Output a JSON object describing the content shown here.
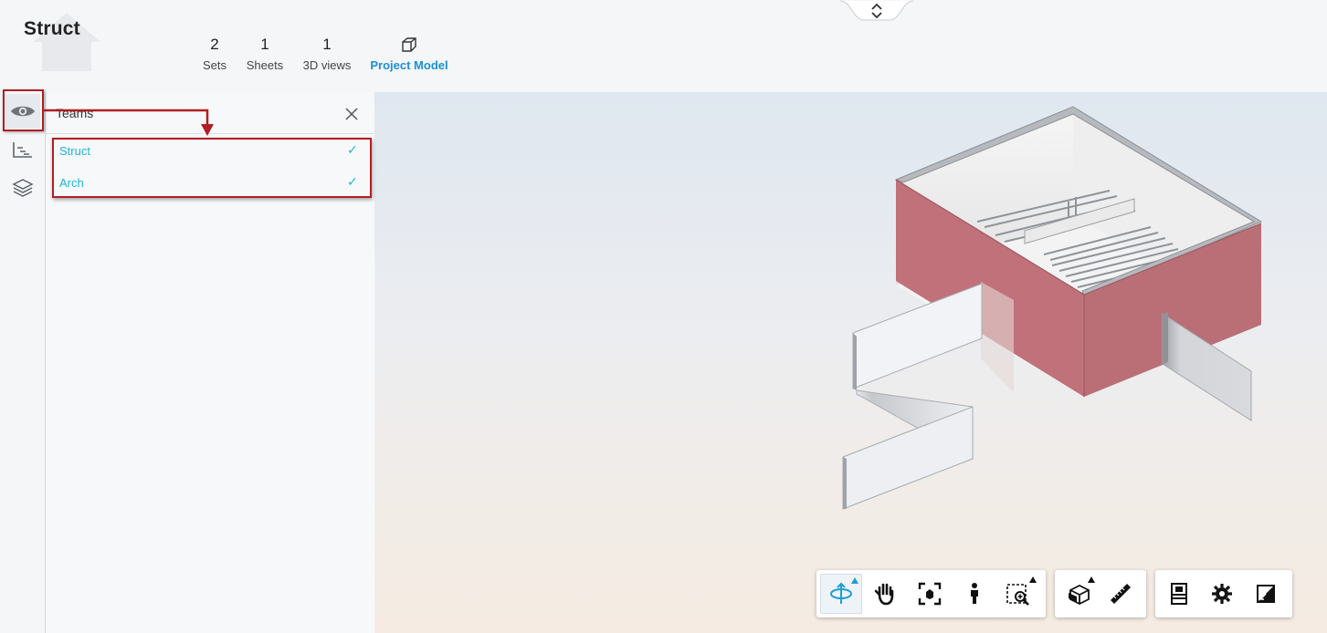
{
  "header": {
    "title": "Struct",
    "stats": [
      {
        "value": "2",
        "label": "Sets"
      },
      {
        "value": "1",
        "label": "Sheets"
      },
      {
        "value": "1",
        "label": "3D views"
      },
      {
        "label": "Project Model",
        "icon": "cube-icon"
      }
    ]
  },
  "rail": {
    "items": [
      {
        "icon": "eye-icon",
        "active": true
      },
      {
        "icon": "hierarchy-icon"
      },
      {
        "icon": "layers-icon"
      }
    ]
  },
  "panel": {
    "title": "Teams",
    "close_icon": "close-icon",
    "teams": [
      {
        "name": "Struct",
        "checked": true
      },
      {
        "name": "Arch",
        "checked": true
      }
    ]
  },
  "toolbar": {
    "groups": [
      [
        "orbit-icon",
        "pan-icon",
        "fit-to-view-icon",
        "first-person-icon",
        "zoom-window-icon"
      ],
      [
        "section-analysis-icon",
        "measure-icon"
      ],
      [
        "model-browser-icon",
        "settings-icon",
        "fullscreen-icon"
      ]
    ]
  },
  "colors": {
    "accent": "#1bb5d6",
    "highlight": "#b11e22",
    "wall_red": "#c0737a",
    "link": "#1b8fd6"
  }
}
